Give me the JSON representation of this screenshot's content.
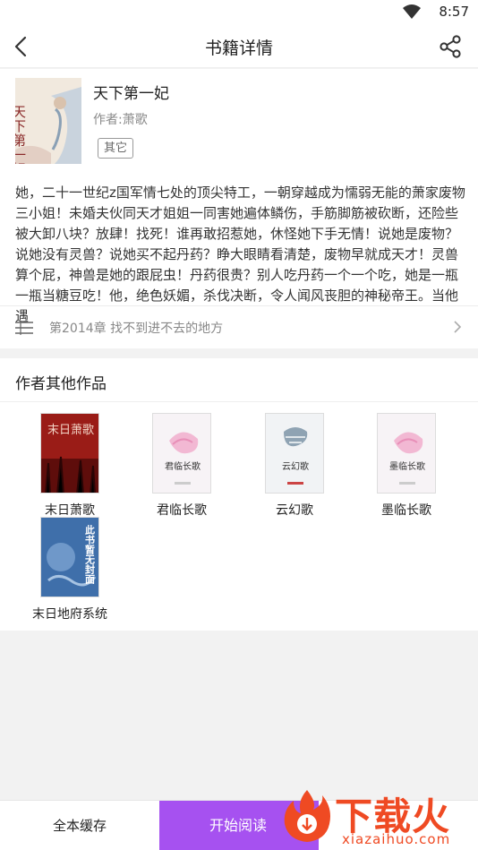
{
  "status_bar": {
    "time": "8:57"
  },
  "nav": {
    "title": "书籍详情"
  },
  "book": {
    "title": "天下第一妃",
    "author": "作者:萧歌",
    "tag": "其它",
    "cover_text": "天下第一妃",
    "description": "她，二十一世纪z国军情七处的顶尖特工，一朝穿越成为懦弱无能的萧家废物三小姐！未婚夫伙同天才姐姐一同害她遍体鳞伤，手筋脚筋被砍断，还险些被大卸八块？放肆！找死！谁再敢招惹她，休怪她下手无情！说她是废物？说她没有灵兽？说她买不起丹药？睁大眼睛看清楚，废物早就成天才！灵兽算个屁，神兽是她的跟屁虫！丹药很贵？别人吃丹药一个一个吃，她是一瓶一瓶当糖豆吃！他，绝色妖媚，杀伐决断，令人闻风丧胆的神秘帝王。当他遇",
    "latest_chapter": "第2014章 找不到进不去的地方"
  },
  "other_works": {
    "title": "作者其他作品",
    "items": [
      {
        "name": "末日萧歌",
        "cover_text": "末日萧歌"
      },
      {
        "name": "君临长歌",
        "cover_text": "君临长歌"
      },
      {
        "name": "云幻歌",
        "cover_text": "云幻歌"
      },
      {
        "name": "墨临长歌",
        "cover_text": "墨临长歌"
      },
      {
        "name": "末日地府系统",
        "cover_text": "此书暂无封面"
      }
    ]
  },
  "bottom": {
    "cache_label": "全本缓存",
    "read_label": "开始阅读"
  },
  "watermark": {
    "text": "下载火",
    "sub": "xiazaihuo.com"
  },
  "colors": {
    "accent": "#a651f0",
    "watermark": "#ef4a23"
  }
}
